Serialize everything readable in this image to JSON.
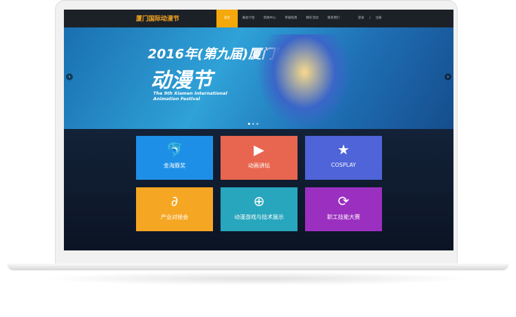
{
  "nav": {
    "logo": "厦门国际动漫节",
    "items": [
      "首页",
      "展会介绍",
      "新闻中心",
      "参展指南",
      "精彩活动",
      "联系我们"
    ],
    "active": 0,
    "login": "登录",
    "register": "注册"
  },
  "banner": {
    "line1": "2016年(第九届)厦门国际",
    "line2": "动漫节",
    "line3": "The 9th Xiamen International Animation Festival",
    "prev": "‹",
    "next": "›"
  },
  "tiles": [
    {
      "label": "金海豚奖",
      "icon": "dolphin-icon",
      "glyph": "🐬",
      "color": "#1e8fe6"
    },
    {
      "label": "动画讲坛",
      "icon": "film-icon",
      "glyph": "▶",
      "color": "#e8664f"
    },
    {
      "label": "COSPLAY",
      "icon": "medal-icon",
      "glyph": "★",
      "color": "#4f64d8"
    },
    {
      "label": "产业对接会",
      "icon": "paperclip-icon",
      "glyph": "∂",
      "color": "#f5a623"
    },
    {
      "label": "动漫游戏与技术展示",
      "icon": "gamepad-icon",
      "glyph": "⊕",
      "color": "#28a6bd"
    },
    {
      "label": "职工技能大赛",
      "icon": "refresh-icon",
      "glyph": "⟳",
      "color": "#9b2fc0"
    }
  ]
}
